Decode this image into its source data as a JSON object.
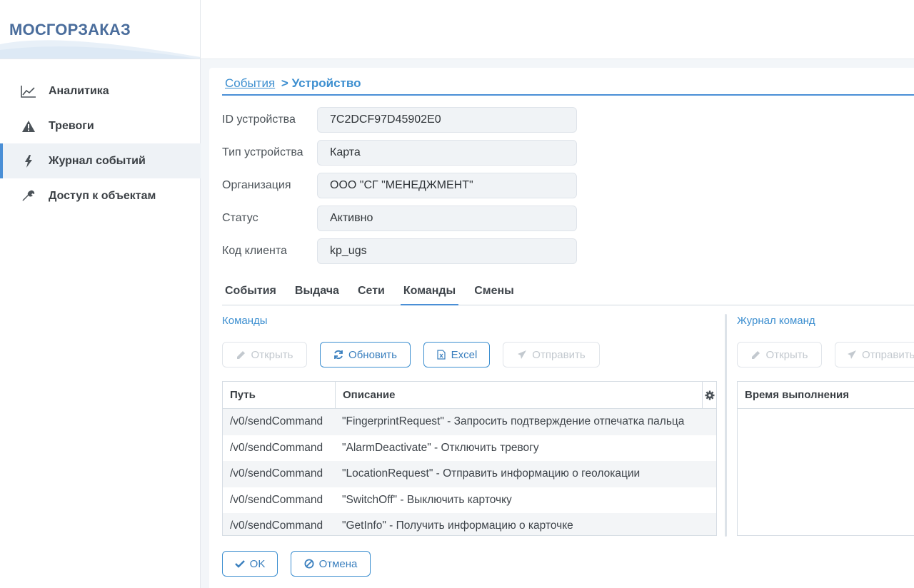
{
  "app": {
    "logo": "МОСГОРЗАКАЗ"
  },
  "sidebar": {
    "items": [
      {
        "label": "Аналитика",
        "icon": "chart-line-icon"
      },
      {
        "label": "Тревоги",
        "icon": "warning-icon"
      },
      {
        "label": "Журнал событий",
        "icon": "bolt-icon",
        "active": true
      },
      {
        "label": "Доступ к объектам",
        "icon": "wrench-icon"
      }
    ]
  },
  "breadcrumb": {
    "parent": "События",
    "current": "> Устройство"
  },
  "form": {
    "device_id": {
      "label": "ID устройства",
      "value": "7C2DCF97D45902E0"
    },
    "device_type": {
      "label": "Тип устройства",
      "value": "Карта"
    },
    "organization": {
      "label": "Организация",
      "value": "ООО \"СГ \"МЕНЕДЖМЕНТ\""
    },
    "status": {
      "label": "Статус",
      "value": "Активно"
    },
    "client_code": {
      "label": "Код клиента",
      "value": "kp_ugs"
    }
  },
  "tabs": [
    {
      "label": "События"
    },
    {
      "label": "Выдача"
    },
    {
      "label": "Сети"
    },
    {
      "label": "Команды",
      "active": true
    },
    {
      "label": "Смены"
    }
  ],
  "commands": {
    "title": "Команды",
    "buttons": {
      "open": "Открыть",
      "refresh": "Обновить",
      "excel": "Excel",
      "send": "Отправить"
    },
    "columns": {
      "path": "Путь",
      "description": "Описание"
    },
    "rows": [
      {
        "path": "/v0/sendCommand",
        "description": "\"FingerprintRequest\" - Запросить подтверждение отпечатка пальца"
      },
      {
        "path": "/v0/sendCommand",
        "description": "\"AlarmDeactivate\" - Отключить тревогу"
      },
      {
        "path": "/v0/sendCommand",
        "description": "\"LocationRequest\" - Отправить информацию о геолокации"
      },
      {
        "path": "/v0/sendCommand",
        "description": "\"SwitchOff\" - Выключить карточку"
      },
      {
        "path": "/v0/sendCommand",
        "description": "\"GetInfo\" - Получить информацию о карточке"
      }
    ]
  },
  "journal": {
    "title": "Журнал команд",
    "buttons": {
      "open": "Открыть",
      "send": "Отправить"
    },
    "columns": {
      "exec_time": "Время выполнения"
    }
  },
  "footer": {
    "ok": "OK",
    "cancel": "Отмена"
  },
  "colors": {
    "accent": "#3d8fd0",
    "logo": "#4a6d9c",
    "active_bar": "#4a8fd6"
  }
}
